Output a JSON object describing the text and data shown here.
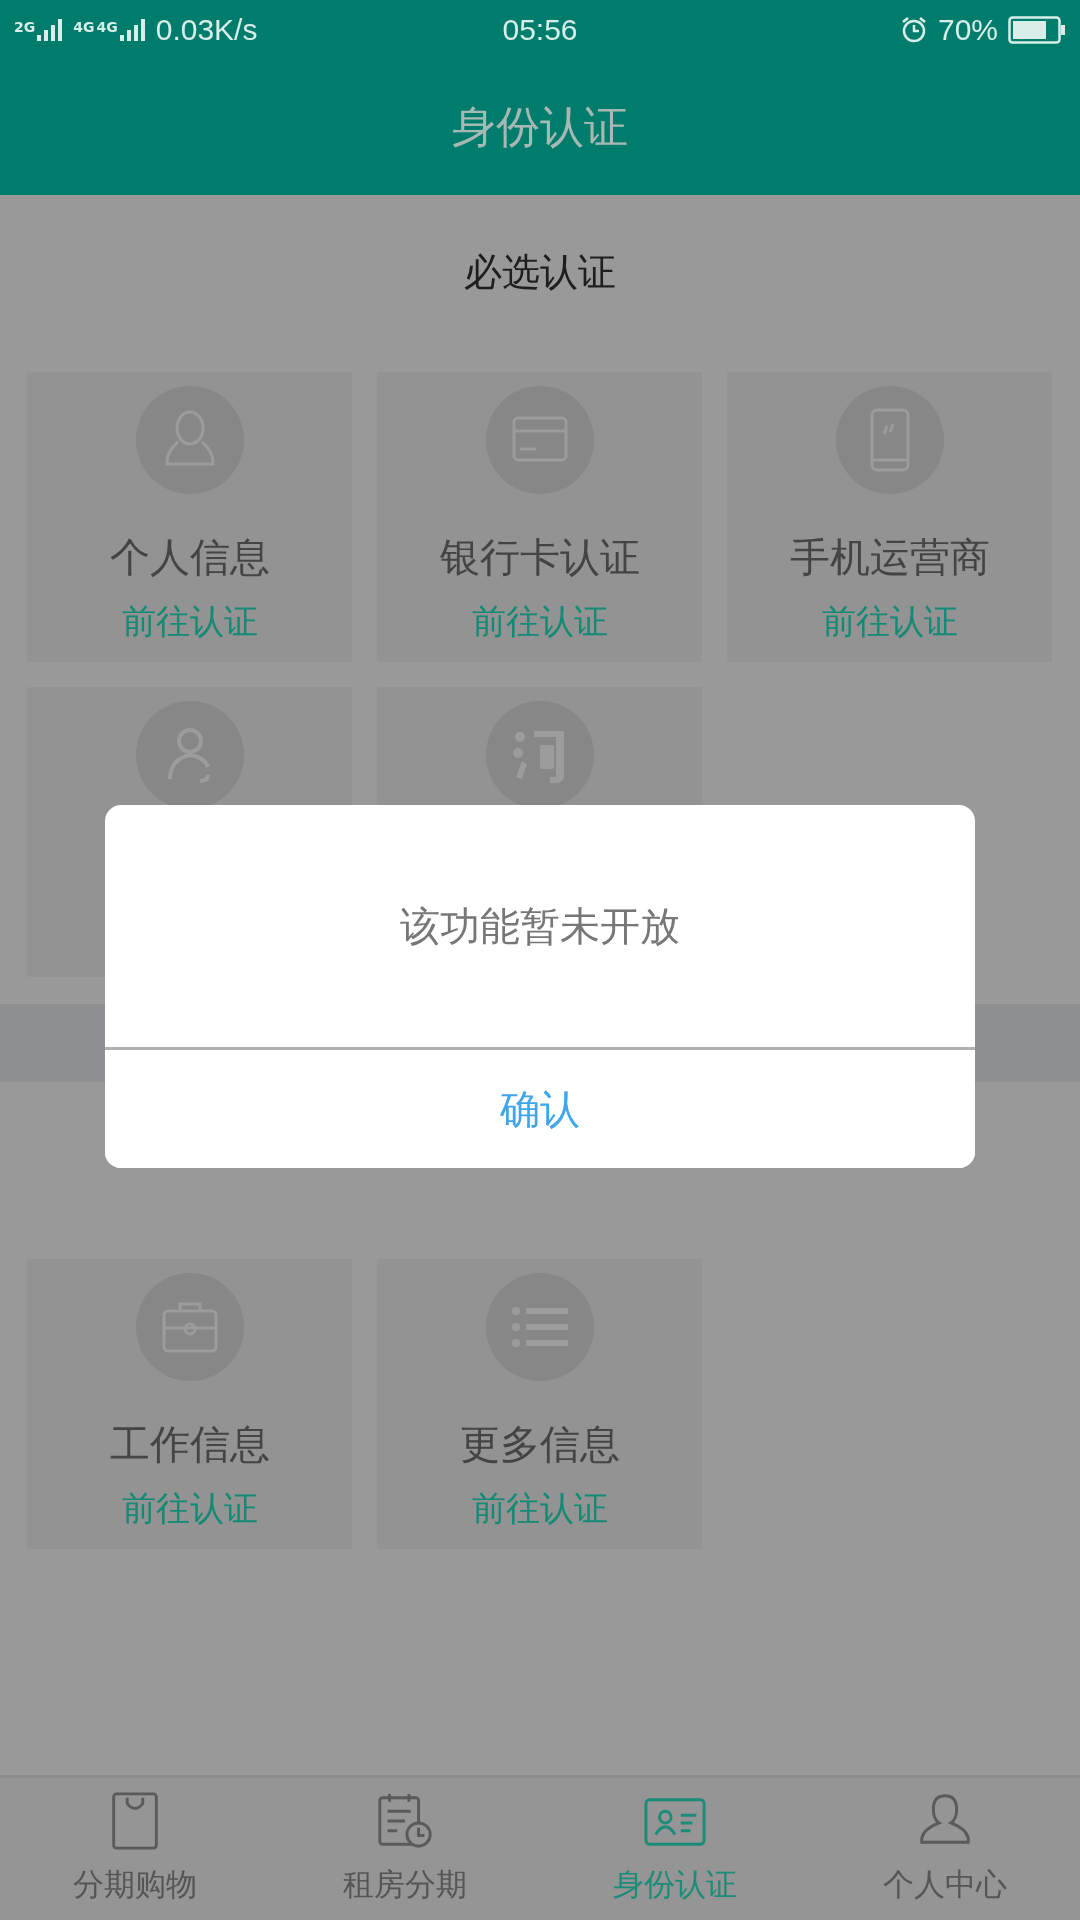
{
  "status_bar": {
    "signal_1": "2G",
    "signal_2": "4G",
    "signal_3": "4G",
    "speed": "0.03K/s",
    "time": "05:56",
    "battery": "70%"
  },
  "header": {
    "title": "身份认证"
  },
  "sections": [
    {
      "title": "必选认证",
      "cards": [
        {
          "kind": "person",
          "label": "个人信息",
          "action": "前往认证"
        },
        {
          "kind": "card",
          "label": "银行卡认证",
          "action": "前往认证"
        },
        {
          "kind": "phone",
          "label": "手机运营商",
          "action": "前往认证"
        },
        {
          "kind": "contact"
        },
        {
          "kind": "tao"
        }
      ]
    },
    {
      "cards": [
        {
          "kind": "briefcase",
          "label": "工作信息",
          "action": "前往认证"
        },
        {
          "kind": "list",
          "label": "更多信息",
          "action": "前往认证"
        }
      ]
    }
  ],
  "dialog": {
    "message": "该功能暂未开放",
    "button": "确认"
  },
  "tabs": [
    {
      "kind": "bag",
      "label": "分期购物",
      "selected": false
    },
    {
      "kind": "calendar",
      "label": "租房分期",
      "selected": false
    },
    {
      "kind": "idcard",
      "label": "身份认证",
      "selected": true
    },
    {
      "kind": "user",
      "label": "个人中心",
      "selected": false
    }
  ]
}
